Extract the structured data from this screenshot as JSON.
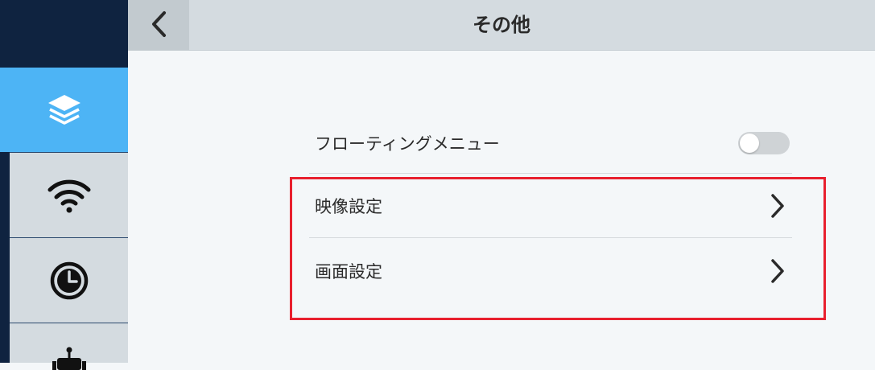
{
  "header": {
    "title": "その他",
    "back_icon": "chevron-left-icon"
  },
  "sidebar": {
    "items": [
      {
        "id": "layers",
        "icon": "layers-icon",
        "active": true
      },
      {
        "id": "wifi",
        "icon": "wifi-icon",
        "active": false
      },
      {
        "id": "clock",
        "icon": "clock-icon",
        "active": false
      },
      {
        "id": "robot",
        "icon": "robot-icon",
        "active": false
      }
    ]
  },
  "settings": {
    "floating_menu": {
      "label": "フローティングメニュー",
      "enabled": false
    },
    "video_settings": {
      "label": "映像設定"
    },
    "screen_settings": {
      "label": "画面設定"
    }
  },
  "colors": {
    "accent": "#4db4f5",
    "sidebar_dark": "#0f2340",
    "header_bg": "#d4dbe0",
    "highlight": "#e8202e"
  }
}
